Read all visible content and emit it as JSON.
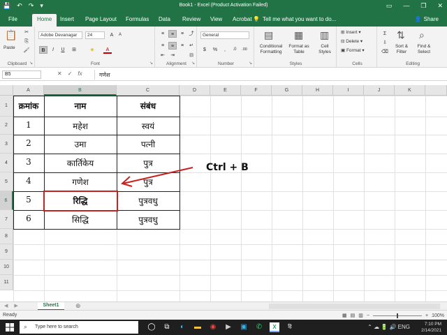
{
  "titlebar": {
    "title": "Book1 - Excel (Product Activation Failed)",
    "qat_save": "💾",
    "qat_undo": "↶",
    "qat_redo": "↷",
    "qat_more": "▾",
    "icon_min": "—",
    "icon_restore": "❐",
    "icon_close": "✕",
    "ribbon_opts": "▭"
  },
  "tabs": {
    "file": "File",
    "home": "Home",
    "insert": "Insert",
    "page_layout": "Page Layout",
    "formulas": "Formulas",
    "data": "Data",
    "review": "Review",
    "view": "View",
    "acrobat": "Acrobat",
    "tell_me": "Tell me what you want to do...",
    "tell_icon": "💡",
    "share": "Share",
    "share_icon": "👤"
  },
  "ribbon": {
    "clipboard": {
      "label": "Clipboard",
      "paste": "Paste",
      "paste_icon": "📋",
      "cut": "✂",
      "copy": "⎘",
      "painter": "🖌"
    },
    "font": {
      "label": "Font",
      "name": "Adobe Devanagar",
      "size": "24",
      "bold": "B",
      "italic": "I",
      "underline": "U",
      "grow": "A",
      "shrink": "A",
      "borders": "⊞",
      "fill": "◈",
      "color": "A",
      "caret": "▾"
    },
    "alignment": {
      "label": "Alignment",
      "top": "≡",
      "mid": "≡",
      "bot": "≡",
      "left": "≡",
      "center": "≡",
      "right": "≡",
      "orient": "⤴",
      "wrap": "↵",
      "merge": "⊟",
      "indent_dec": "⇤",
      "indent_inc": "⇥"
    },
    "number": {
      "label": "Number",
      "format": "General",
      "currency": "$",
      "percent": "%",
      "comma": ",",
      "inc": ".0",
      "dec": ".00"
    },
    "styles": {
      "label": "Styles",
      "conditional": "Conditional",
      "conditional2": "Formatting",
      "format_as": "Format as",
      "format_as2": "Table",
      "cell_styles": "Cell",
      "cell_styles2": "Styles"
    },
    "cells": {
      "label": "Cells",
      "insert": "Insert",
      "delete": "Delete",
      "format": "Format"
    },
    "editing": {
      "label": "Editing",
      "sum": "Σ",
      "sort": "Sort &",
      "sort2": "Filter",
      "find": "Find &",
      "find2": "Select",
      "fill": "⇩",
      "clear": "⌫"
    }
  },
  "formula_bar": {
    "name_box": "B5",
    "cancel": "✕",
    "enter": "✓",
    "fx": "fx",
    "content": "गणेश"
  },
  "grid": {
    "columns": [
      "A",
      "B",
      "C",
      "D",
      "E",
      "F",
      "G",
      "H",
      "I",
      "J",
      "K"
    ],
    "rows": [
      "1",
      "2",
      "3",
      "4",
      "5",
      "6",
      "7",
      "8",
      "9",
      "10",
      "11"
    ],
    "table": {
      "headers": [
        "क्रमांक",
        "नाम",
        "संबंध"
      ],
      "rows": [
        [
          "1",
          "महेश",
          "स्वयं"
        ],
        [
          "2",
          "उमा",
          "पत्नी"
        ],
        [
          "3",
          "कार्तिकेय",
          "पुत्र"
        ],
        [
          "4",
          "गणेश",
          "पुत्र"
        ],
        [
          "5",
          "रिद्धि",
          "पुत्रवधु"
        ],
        [
          "6",
          "सिद्धि",
          "पुत्रवधु"
        ]
      ]
    },
    "selected_cell": "B5",
    "selected_row_index": 4,
    "selected_col_index": 1
  },
  "annotation": {
    "text": "Ctrl + B",
    "color": "#c8201f"
  },
  "sheets": {
    "active": "Sheet1",
    "add": "⊕",
    "prev": "◀",
    "next": "▶"
  },
  "status": {
    "ready": "Ready",
    "zoom": "100%",
    "zoom_minus": "−",
    "zoom_plus": "+",
    "view_normal": "▦",
    "view_layout": "▤",
    "view_break": "▥"
  },
  "taskbar": {
    "search_placeholder": "Type here to search",
    "search_icon": "⌕",
    "time": "7:10 PM",
    "date": "2/14/2021",
    "apps": [
      {
        "name": "task-view-icon",
        "glyph": "◯",
        "color": "#ffffff"
      },
      {
        "name": "task-switch-icon",
        "glyph": "⧉",
        "color": "#ffffff"
      },
      {
        "name": "edge-icon",
        "glyph": "◐",
        "color": "#3ab0e8"
      },
      {
        "name": "file-explorer-icon",
        "glyph": "▬",
        "color": "#f4c542"
      },
      {
        "name": "chrome-icon",
        "glyph": "◉",
        "color": "#e8453c"
      },
      {
        "name": "media-icon",
        "glyph": "▶",
        "color": "#cccccc"
      },
      {
        "name": "store-icon",
        "glyph": "▣",
        "color": "#3ab0e8"
      },
      {
        "name": "whatsapp-icon",
        "glyph": "✆",
        "color": "#25d366"
      },
      {
        "name": "excel-icon",
        "glyph": "X",
        "color": "#21a366"
      },
      {
        "name": "hindi-ime-icon",
        "glyph": "हि",
        "color": "#ffffff"
      }
    ],
    "tray_icons": "⌃ ☁ 🔋 🔊 ENG",
    "notifications": "🗨"
  }
}
